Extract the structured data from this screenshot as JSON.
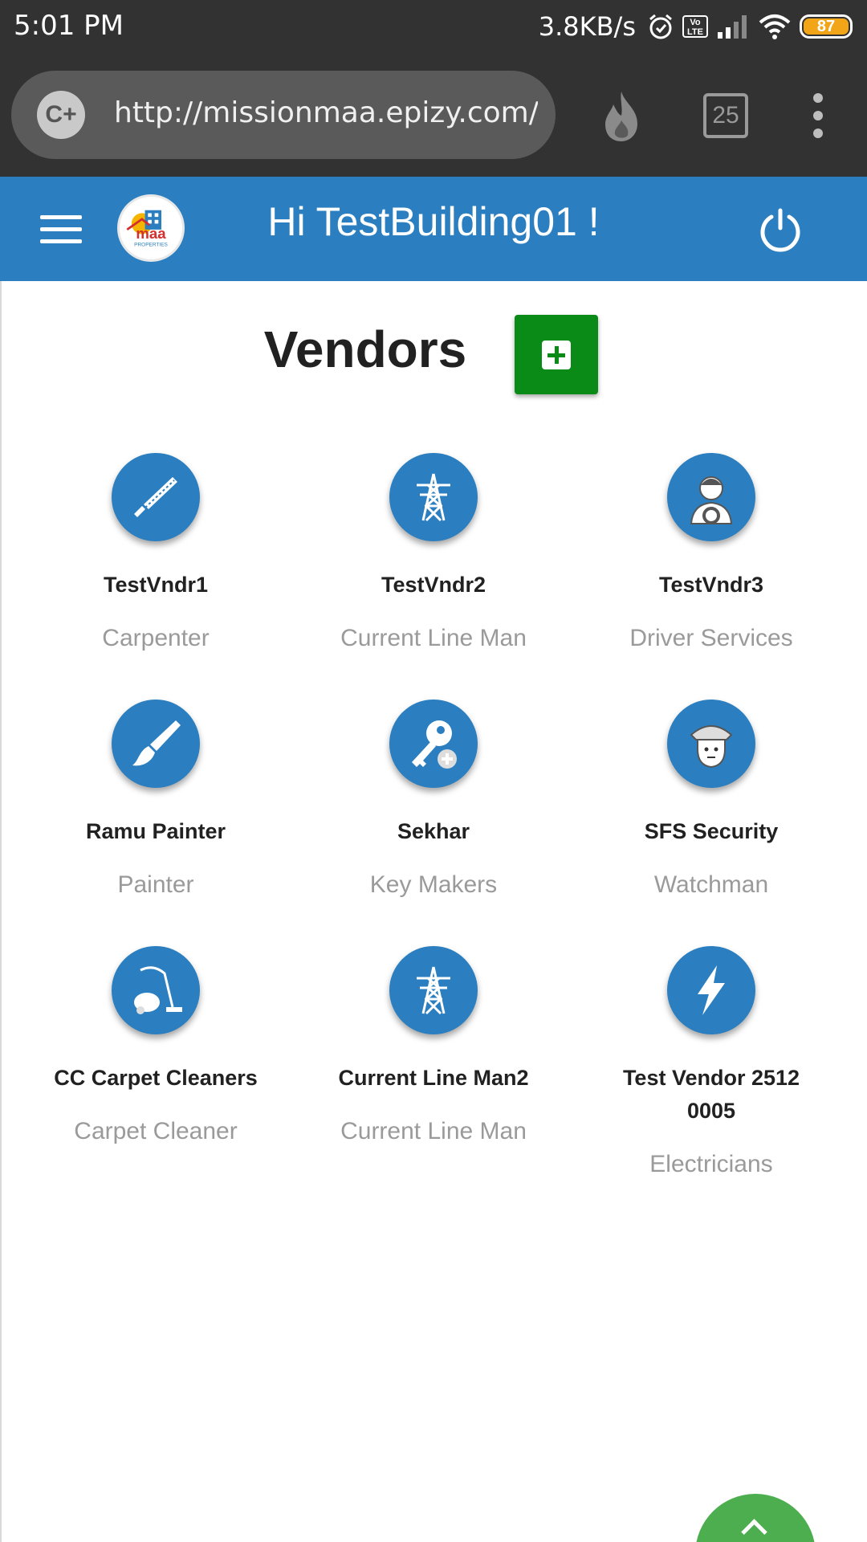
{
  "status_bar": {
    "time": "5:01 PM",
    "network_speed": "3.8KB/s",
    "volte_label": "Vo LTE",
    "battery_level": "87",
    "icons": [
      "alarm-icon",
      "volte-icon",
      "signal-icon",
      "wifi-icon",
      "battery-icon"
    ]
  },
  "browser": {
    "url": "http://missionmaa.epizy.com/v",
    "site_icon": "C+",
    "tab_count": "25",
    "icons": [
      "fire-icon",
      "tabs-icon",
      "menu-dots-icon"
    ]
  },
  "app_header": {
    "greeting": "Hi TestBuilding01 !",
    "logo_text": "maa",
    "logo_subtext": "PROPERTIES",
    "color": "#2b7fc0"
  },
  "page": {
    "title": "Vendors",
    "add_button_color": "#0a8a16"
  },
  "vendors": [
    {
      "name": "TestVndr1",
      "category": "Carpenter",
      "icon": "saw-icon"
    },
    {
      "name": "TestVndr2",
      "category": "Current Line Man",
      "icon": "power-tower-icon"
    },
    {
      "name": "TestVndr3",
      "category": "Driver Services",
      "icon": "driver-icon"
    },
    {
      "name": "Ramu Painter",
      "category": "Painter",
      "icon": "paintbrush-icon"
    },
    {
      "name": "Sekhar",
      "category": "Key Makers",
      "icon": "key-icon"
    },
    {
      "name": "SFS Security",
      "category": "Watchman",
      "icon": "guard-icon"
    },
    {
      "name": "CC Carpet Cleaners",
      "category": "Carpet Cleaner",
      "icon": "vacuum-icon"
    },
    {
      "name": "Current Line Man2",
      "category": "Current Line Man",
      "icon": "power-tower-icon"
    },
    {
      "name": "Test Vendor 2512 0005",
      "category": "Electricians",
      "icon": "lightning-icon"
    }
  ]
}
